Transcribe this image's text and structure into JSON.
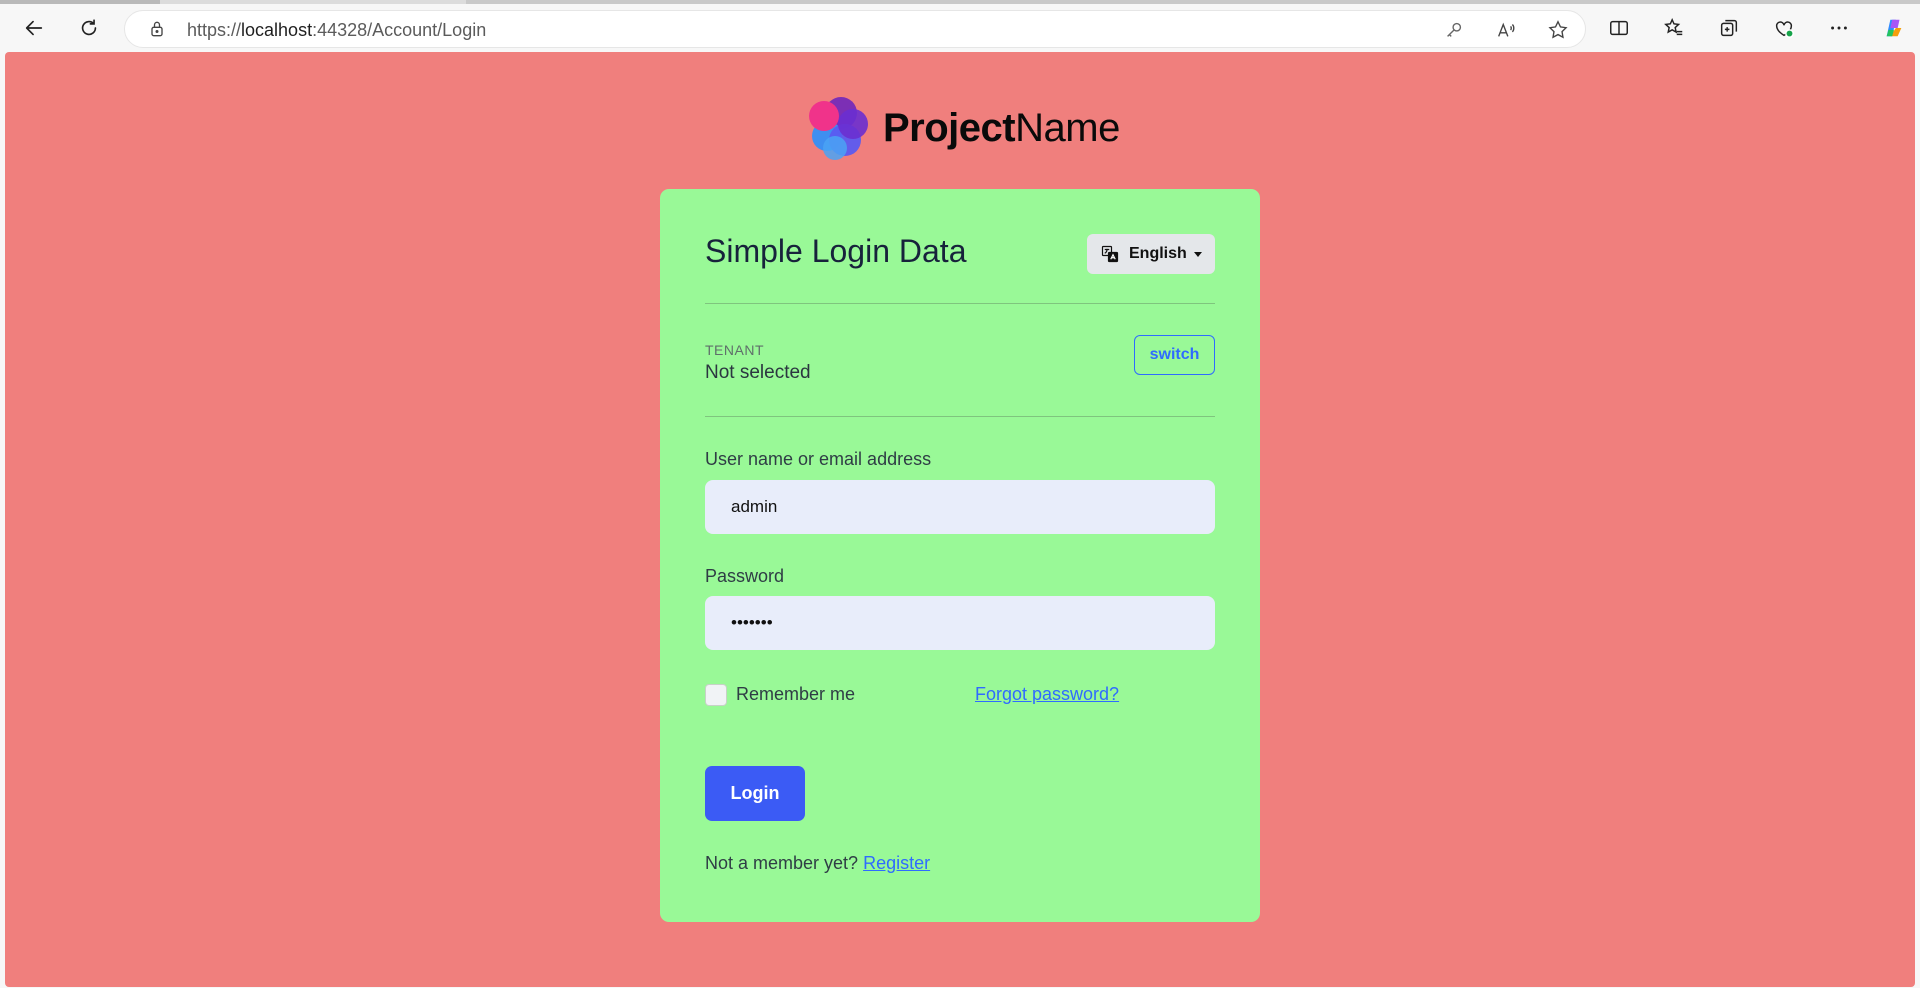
{
  "browser": {
    "url_prefix": "https://",
    "url_host": "localhost",
    "url_rest": ":44328/Account/Login",
    "icons": [
      "back-icon",
      "refresh-icon",
      "lock-icon",
      "key-icon",
      "read-aloud-icon",
      "favorite-star-icon",
      "split-screen-icon",
      "favorites-icon",
      "collections-icon",
      "browser-essentials-icon",
      "more-icon",
      "copilot-icon"
    ]
  },
  "brand": {
    "name_bold": "Project",
    "name_regular": "Name"
  },
  "card": {
    "title": "Simple Login Data",
    "language_button": "English",
    "tenant_caption": "TENANT",
    "tenant_value": "Not selected",
    "switch_button": "switch",
    "username_label": "User name or email address",
    "username_value": "admin",
    "password_label": "Password",
    "password_value": "•••••••",
    "remember_label": "Remember me",
    "forgot_link": "Forgot password?",
    "login_button": "Login",
    "not_member_text": "Not a member yet?",
    "register_link": "Register"
  },
  "colors": {
    "page_background": "#f07f7d",
    "card_background": "#99f997",
    "primary": "#3b5bf5",
    "link": "#2f6bff",
    "input_background": "#e8edfa"
  }
}
